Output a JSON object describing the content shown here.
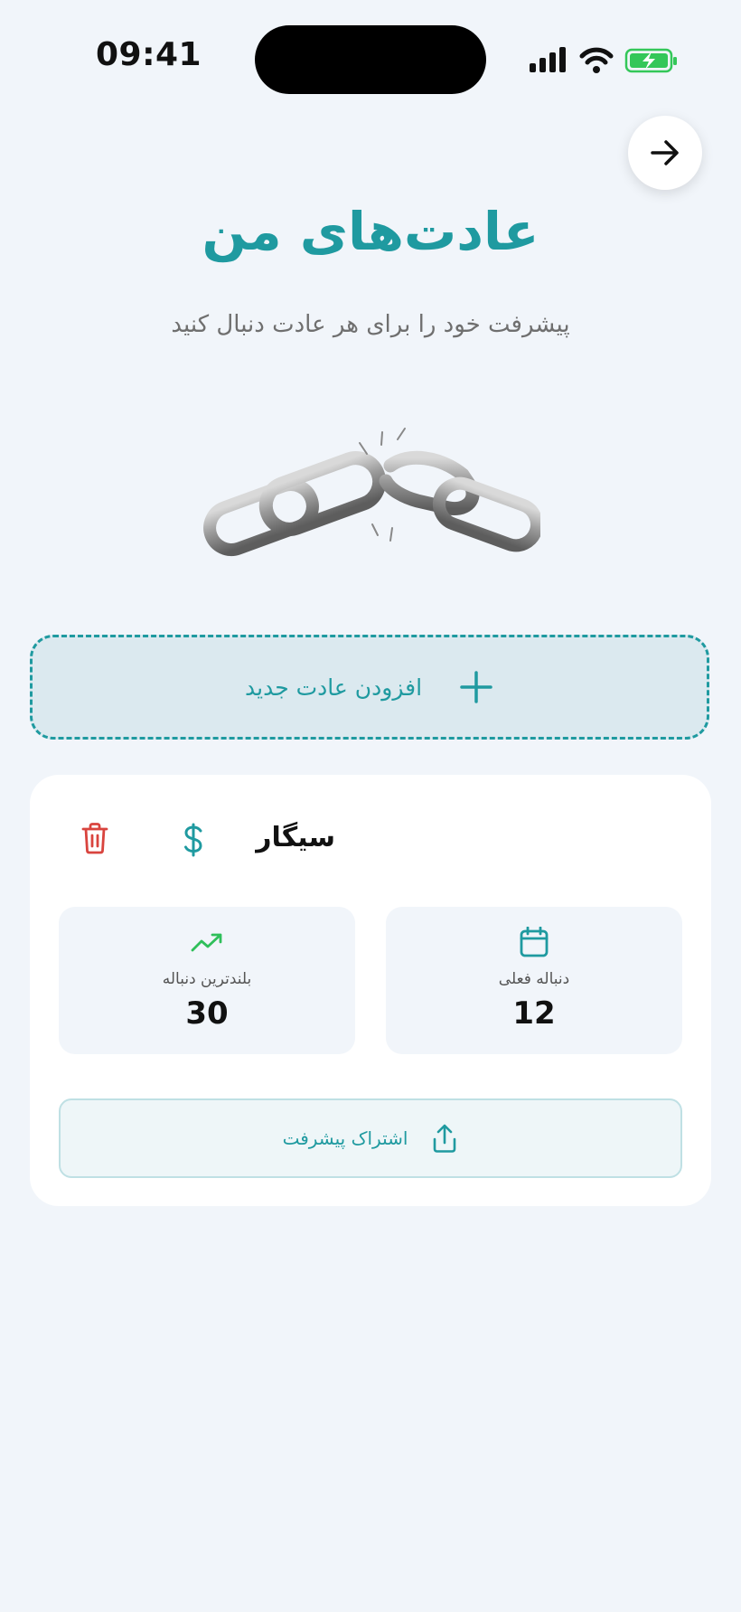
{
  "status_bar": {
    "time": "09:41",
    "icons": [
      "signal-icon",
      "wifi-icon",
      "battery-charging-icon"
    ]
  },
  "header": {
    "back_icon": "arrow-right-icon",
    "title": "عادت‌های من",
    "subtitle": "پیشرفت خود را برای هر عادت دنبال کنید",
    "illustration": "broken-chain-icon"
  },
  "add_habit": {
    "label": "افزودن عادت جدید",
    "icon": "plus-icon"
  },
  "habit_card": {
    "name": "سیگار",
    "icon": "dollar-icon",
    "delete_icon": "trash-icon",
    "stats": [
      {
        "label": "دنباله فعلی",
        "value": "12",
        "icon": "calendar-icon"
      },
      {
        "label": "بلندترین دنباله",
        "value": "30",
        "icon": "trending-up-icon"
      }
    ],
    "share_label": "اشتراک پیشرفت",
    "share_icon": "share-icon"
  },
  "colors": {
    "accent": "#1f9aa0",
    "background": "#f1f5fa",
    "danger": "#d9443e",
    "success": "#2fbf5a",
    "battery": "#34c759"
  }
}
